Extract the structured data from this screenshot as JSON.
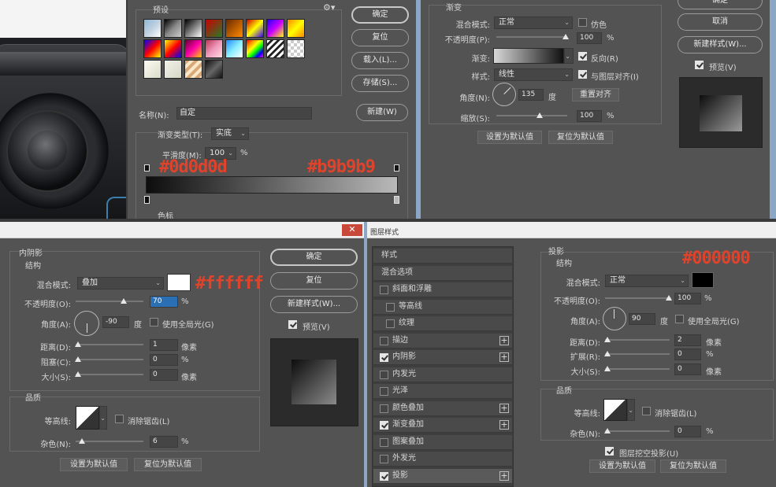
{
  "gradient_editor": {
    "presets_label": "预设",
    "gear_icon": "gear-icon",
    "name_label": "名称(N):",
    "name_value": "自定",
    "gradient_type_label": "渐变类型(T):",
    "gradient_type_value": "实底",
    "smoothness_label": "平滑度(M):",
    "smoothness_value": "100",
    "smoothness_unit": "%",
    "color_stop_label": "色标",
    "left_color_annotation": "#0d0d0d",
    "right_color_annotation": "#b9b9b9",
    "gradient_start": "#0d0d0d",
    "gradient_end": "#b9b9b9",
    "buttons": {
      "ok": "确定",
      "reset": "复位",
      "load": "载入(L)...",
      "save": "存储(S)...",
      "new": "新建(W)"
    }
  },
  "gradient_overlay": {
    "section_title": "渐变",
    "blend_mode_label": "混合模式:",
    "blend_mode_value": "正常",
    "dither_label": "仿色",
    "opacity_label": "不透明度(P):",
    "opacity_value": "100",
    "opacity_unit": "%",
    "gradient_label": "渐变:",
    "reverse_label": "反向(R)",
    "style_label": "样式:",
    "style_value": "线性",
    "align_label": "与图层对齐(I)",
    "angle_label": "角度(N):",
    "angle_value": "135",
    "angle_unit": "度",
    "reset_align": "重置对齐",
    "scale_label": "缩放(S):",
    "scale_value": "100",
    "scale_unit": "%",
    "make_default": "设置为默认值",
    "reset_default": "复位为默认值",
    "right_buttons": {
      "ok": "确定",
      "cancel": "取消",
      "new_style": "新建样式(W)...",
      "preview": "预览(V)"
    }
  },
  "inner_shadow": {
    "section_title": "内阴影",
    "structure_label": "结构",
    "blend_mode_label": "混合模式:",
    "blend_mode_value": "叠加",
    "color_annotation": "#ffffff",
    "opacity_label": "不透明度(O):",
    "opacity_value": "70",
    "opacity_unit": "%",
    "angle_label": "角度(A):",
    "angle_value": "-90",
    "angle_unit": "度",
    "global_light_label": "使用全局光(G)",
    "distance_label": "距离(D):",
    "distance_value": "1",
    "distance_unit": "像素",
    "choke_label": "阻塞(C):",
    "choke_value": "0",
    "choke_unit": "%",
    "size_label": "大小(S):",
    "size_value": "0",
    "size_unit": "像素",
    "quality_label": "品质",
    "contour_label": "等高线:",
    "antialias_label": "消除锯齿(L)",
    "noise_label": "杂色(N):",
    "noise_value": "6",
    "noise_unit": "%",
    "make_default": "设置为默认值",
    "reset_default": "复位为默认值",
    "right_buttons": {
      "ok": "确定",
      "reset": "复位",
      "new_style": "新建样式(W)...",
      "preview": "预览(V)"
    }
  },
  "layer_style_window": {
    "title": "图层样式",
    "close_icon": "close-icon",
    "styles": [
      {
        "label": "样式",
        "checkbox": false,
        "checked": false,
        "plus": false
      },
      {
        "label": "混合选项",
        "checkbox": false,
        "checked": false,
        "plus": false
      },
      {
        "label": "斜面和浮雕",
        "checkbox": true,
        "checked": false,
        "plus": false
      },
      {
        "label": "等高线",
        "checkbox": true,
        "checked": false,
        "plus": false,
        "indent": true
      },
      {
        "label": "纹理",
        "checkbox": true,
        "checked": false,
        "plus": false,
        "indent": true
      },
      {
        "label": "描边",
        "checkbox": true,
        "checked": false,
        "plus": true
      },
      {
        "label": "内阴影",
        "checkbox": true,
        "checked": true,
        "plus": true
      },
      {
        "label": "内发光",
        "checkbox": true,
        "checked": false,
        "plus": false
      },
      {
        "label": "光泽",
        "checkbox": true,
        "checked": false,
        "plus": false
      },
      {
        "label": "颜色叠加",
        "checkbox": true,
        "checked": false,
        "plus": true
      },
      {
        "label": "渐变叠加",
        "checkbox": true,
        "checked": true,
        "plus": true
      },
      {
        "label": "图案叠加",
        "checkbox": true,
        "checked": false,
        "plus": false
      },
      {
        "label": "外发光",
        "checkbox": true,
        "checked": false,
        "plus": false
      },
      {
        "label": "投影",
        "checkbox": true,
        "checked": true,
        "plus": true
      }
    ]
  },
  "drop_shadow": {
    "section_title": "投影",
    "structure_label": "结构",
    "color_annotation": "#000000",
    "blend_mode_label": "混合模式:",
    "blend_mode_value": "正常",
    "opacity_label": "不透明度(O):",
    "opacity_value": "100",
    "opacity_unit": "%",
    "angle_label": "角度(A):",
    "angle_value": "90",
    "angle_unit": "度",
    "global_light_label": "使用全局光(G)",
    "distance_label": "距离(D):",
    "distance_value": "2",
    "distance_unit": "像素",
    "spread_label": "扩展(R):",
    "spread_value": "0",
    "spread_unit": "%",
    "size_label": "大小(S):",
    "size_value": "0",
    "size_unit": "像素",
    "quality_label": "品质",
    "contour_label": "等高线:",
    "antialias_label": "消除锯齿(L)",
    "noise_label": "杂色(N):",
    "noise_value": "0",
    "noise_unit": "%",
    "knockout_label": "图层挖空投影(U)",
    "make_default": "设置为默认值",
    "reset_default": "复位为默认值"
  }
}
